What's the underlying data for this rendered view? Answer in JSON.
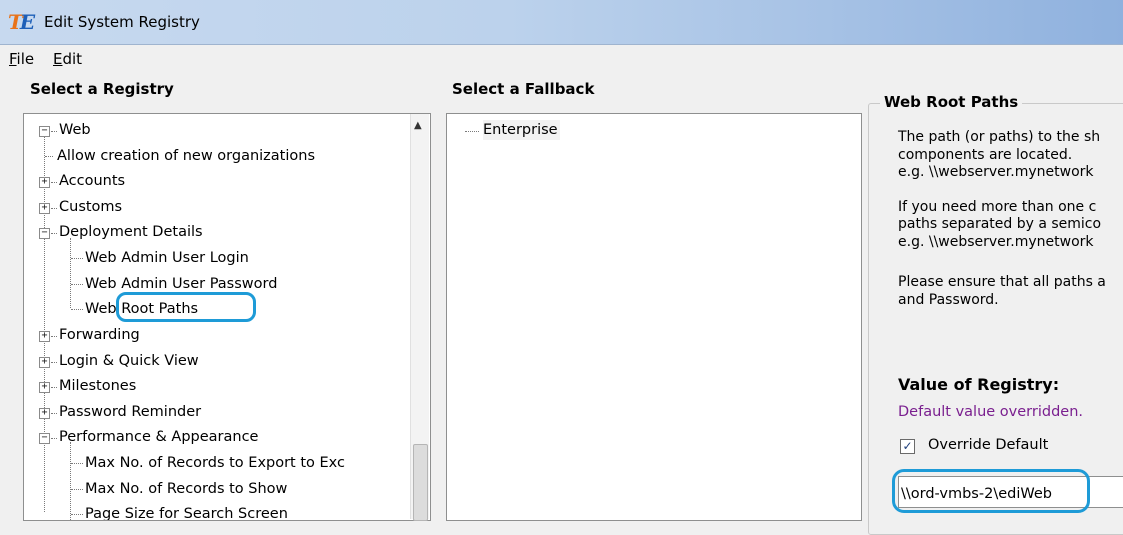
{
  "window": {
    "title": "Edit System Registry"
  },
  "menu": {
    "file": "File",
    "file_key": "F",
    "file_rest": "ile",
    "edit": "Edit",
    "edit_key": "E",
    "edit_rest": "dit"
  },
  "headers": {
    "registry": "Select a Registry",
    "fallback": "Select a Fallback"
  },
  "tree": {
    "root": "Web",
    "items": [
      "Allow creation of new organizations",
      "Accounts",
      "Customs",
      "Deployment Details",
      "Web Admin User Login",
      "Web Admin User Password",
      "Web Root Paths",
      "Forwarding",
      "Login & Quick View",
      "Milestones",
      "Password Reminder",
      "Performance & Appearance",
      "Max No. of Records to Export to Exc",
      "Max No. of Records to Show",
      "Page Size for Search Screen"
    ],
    "expand_plus": "+",
    "expand_minus": "−"
  },
  "fallback": {
    "items": [
      "Enterprise"
    ]
  },
  "details": {
    "group_title": "Web Root Paths",
    "desc_lines": [
      "The path (or paths) to the sh",
      "components are located.",
      "e.g. \\\\webserver.mynetwork",
      "If you need more than one c",
      "paths separated by a semico",
      "e.g. \\\\webserver.mynetwork",
      "Please ensure that all paths a",
      "and Password."
    ],
    "value_header": "Value of Registry:",
    "overridden_note": "Default value overridden.",
    "override_label": "Override Default",
    "override_checked": true,
    "check_glyph": "✓",
    "value": "\\\\ord-vmbs-2\\ediWeb"
  },
  "colors": {
    "highlight": "#1e9bd7",
    "overridden": "#7a1f8f"
  }
}
